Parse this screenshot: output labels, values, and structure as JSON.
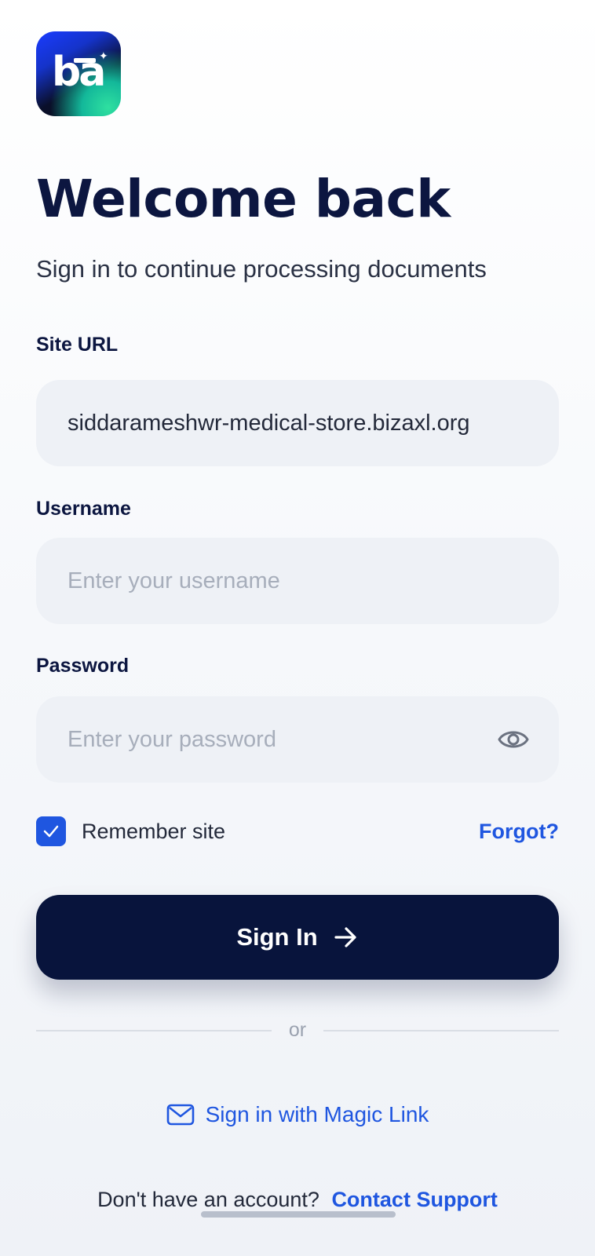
{
  "logo": {
    "text": "bā",
    "icon": "app-logo"
  },
  "header": {
    "title": "Welcome back",
    "subtitle": "Sign in to continue processing documents"
  },
  "form": {
    "site_url": {
      "label": "Site URL",
      "value": "siddarameshwr-medical-store.bizaxl.org"
    },
    "username": {
      "label": "Username",
      "placeholder": "Enter your username",
      "value": ""
    },
    "password": {
      "label": "Password",
      "placeholder": "Enter your password",
      "value": "",
      "toggle_icon": "eye-icon"
    },
    "remember": {
      "label": "Remember site",
      "checked": true
    },
    "forgot_label": "Forgot?",
    "submit_label": "Sign In"
  },
  "divider_text": "or",
  "magic_link": {
    "label": "Sign in with Magic Link",
    "icon": "mail-icon"
  },
  "footer": {
    "text": "Don't have an account?",
    "link": "Contact Support"
  },
  "colors": {
    "primary": "#08143C",
    "accent": "#1F56E0",
    "field_bg": "#EEF1F6"
  }
}
